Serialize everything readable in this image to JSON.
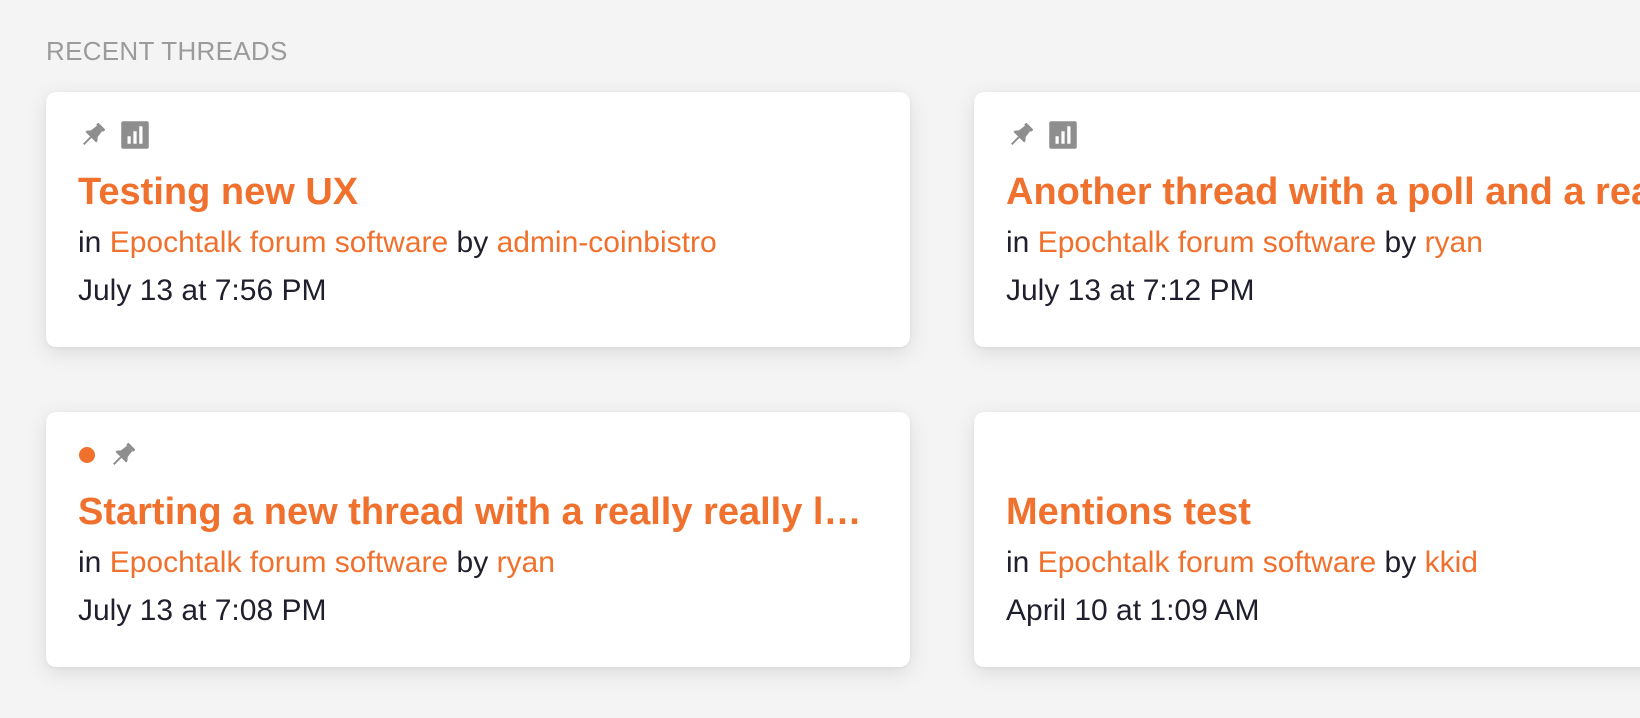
{
  "section": {
    "title": "RECENT THREADS"
  },
  "labels": {
    "in": "in",
    "by": "by"
  },
  "colors": {
    "accent": "#f0702d",
    "icon_gray": "#8e8e8e",
    "text": "#1f1f2e",
    "background": "#f4f4f4"
  },
  "threads": [
    {
      "title": "Testing new UX",
      "board": "Epochtalk forum software",
      "author": "admin-coinbistro",
      "date": "July 13 at 7:56 PM",
      "icons": [
        "pin-icon",
        "poll-icon"
      ]
    },
    {
      "title": "Another thread with a poll and a rea",
      "board": "Epochtalk forum software",
      "author": "ryan",
      "date": "July 13 at 7:12 PM",
      "icons": [
        "pin-icon",
        "poll-icon"
      ]
    },
    {
      "title": "Starting a new thread with a really really lo…",
      "board": "Epochtalk forum software",
      "author": "ryan",
      "date": "July 13 at 7:08 PM",
      "icons": [
        "unread-dot-icon",
        "pin-icon"
      ]
    },
    {
      "title": "Mentions test",
      "board": "Epochtalk forum software",
      "author": "kkid",
      "date": "April 10 at 1:09 AM",
      "icons": []
    }
  ]
}
